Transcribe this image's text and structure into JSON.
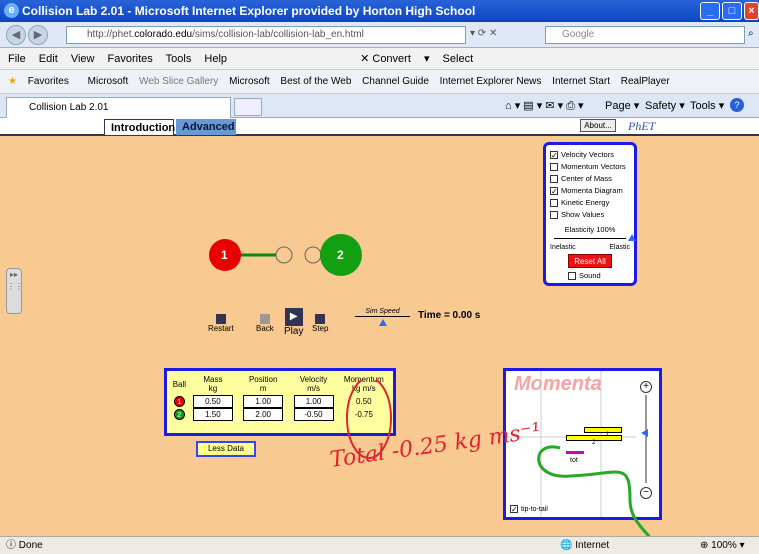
{
  "window": {
    "title": "Collision Lab 2.01 - Microsoft Internet Explorer provided by Horton High School"
  },
  "address": {
    "prefix": "http://phet.",
    "domain": "colorado.edu",
    "path": "/sims/collision-lab/collision-lab_en.html",
    "search_placeholder": "Google"
  },
  "menu": {
    "items": [
      "File",
      "Edit",
      "View",
      "Favorites",
      "Tools",
      "Help"
    ],
    "convert": "Convert",
    "select": "Select"
  },
  "favorites": {
    "label": "Favorites",
    "links": [
      "Microsoft",
      "Web Slice Gallery",
      "Microsoft",
      "Best of the Web",
      "Channel Guide",
      "Internet Explorer News",
      "Internet Start",
      "RealPlayer"
    ]
  },
  "browser_tab": {
    "label": "Collision Lab 2.01"
  },
  "toolbar": {
    "page": "Page",
    "safety": "Safety",
    "tools": "Tools"
  },
  "sim": {
    "tabs": {
      "intro": "Introduction",
      "advanced": "Advanced"
    },
    "about": "About...",
    "brand": "PhET",
    "controls": {
      "restart": "Restart",
      "back": "Back",
      "play": "Play",
      "step": "Step",
      "sim_speed": "Sim Speed",
      "time": "Time = 0.00 s"
    },
    "options": {
      "items": [
        {
          "label": "Velocity Vectors",
          "checked": true
        },
        {
          "label": "Momentum Vectors",
          "checked": false
        },
        {
          "label": "Center of Mass",
          "checked": false
        },
        {
          "label": "Momenta Diagram",
          "checked": true
        },
        {
          "label": "Kinetic Energy",
          "checked": false
        },
        {
          "label": "Show Values",
          "checked": false
        }
      ],
      "elasticity": "Elasticity 100%",
      "inelastic": "Inelastic",
      "elastic": "Elastic",
      "reset": "Reset All",
      "sound": "Sound",
      "elasticity_value": 1.0
    },
    "balls": [
      {
        "id": "1",
        "color": "#e80000"
      },
      {
        "id": "2",
        "color": "#12a012"
      }
    ],
    "table": {
      "headers": [
        [
          "Ball",
          ""
        ],
        [
          "Mass",
          "kg"
        ],
        [
          "Position",
          "m"
        ],
        [
          "Velocity",
          "m/s"
        ],
        [
          "Momentum",
          "kg m/s"
        ]
      ],
      "rows": [
        {
          "ball": "1",
          "mass": "0.50",
          "position": "1.00",
          "velocity": "1.00",
          "momentum": "0.50"
        },
        {
          "ball": "2",
          "mass": "1.50",
          "position": "2.00",
          "velocity": "-0.50",
          "momentum": "-0.75"
        }
      ],
      "less_data": "Less Data"
    },
    "momenta": {
      "title": "Momenta",
      "label1": "1",
      "label2": "2",
      "total": "tot",
      "tip": "tip-to-tail"
    },
    "annotation": "Total -0.25 kg ms⁻¹"
  },
  "status": {
    "done": "Done",
    "zone": "Internet",
    "zoom": "100%"
  },
  "colors": {
    "panel_border": "#1b1be6",
    "sim_bg": "#f8c990",
    "ink": "#e3232f",
    "green_ink": "#27a827"
  }
}
